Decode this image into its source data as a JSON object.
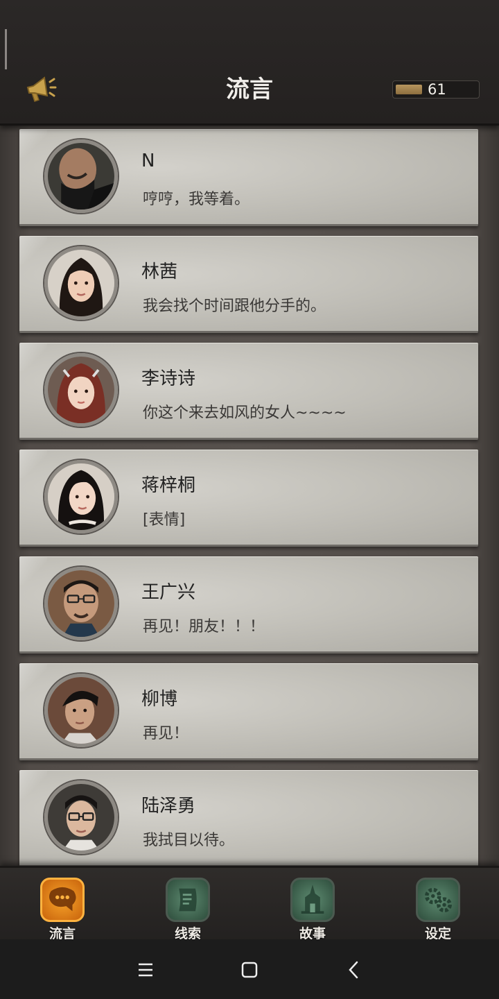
{
  "header": {
    "title": "流言",
    "coin_value": "61",
    "icon": "megaphone-icon"
  },
  "messages": [
    {
      "name": "N",
      "text": "哼哼，我等着。"
    },
    {
      "name": "林茜",
      "text": "我会找个时间跟他分手的。"
    },
    {
      "name": "李诗诗",
      "text": "你这个来去如风的女人~~~~"
    },
    {
      "name": "蒋梓桐",
      "text": "[表情]"
    },
    {
      "name": "王广兴",
      "text": "再见！朋友！！！"
    },
    {
      "name": "柳博",
      "text": "再见！"
    },
    {
      "name": "陆泽勇",
      "text": "我拭目以待。"
    }
  ],
  "tabs": [
    {
      "label": "流言",
      "icon": "chat-bubble-icon",
      "active": true
    },
    {
      "label": "线索",
      "icon": "scroll-icon",
      "active": false
    },
    {
      "label": "故事",
      "icon": "temple-icon",
      "active": false
    },
    {
      "label": "设定",
      "icon": "gears-icon",
      "active": false
    }
  ],
  "system_nav": [
    "menu-icon",
    "home-icon",
    "back-icon"
  ],
  "colors": {
    "accent_active": "#e08a1a",
    "tab_inactive": "#3e6650",
    "card_paper": "#c5c3bc",
    "header_bg": "#272422"
  }
}
